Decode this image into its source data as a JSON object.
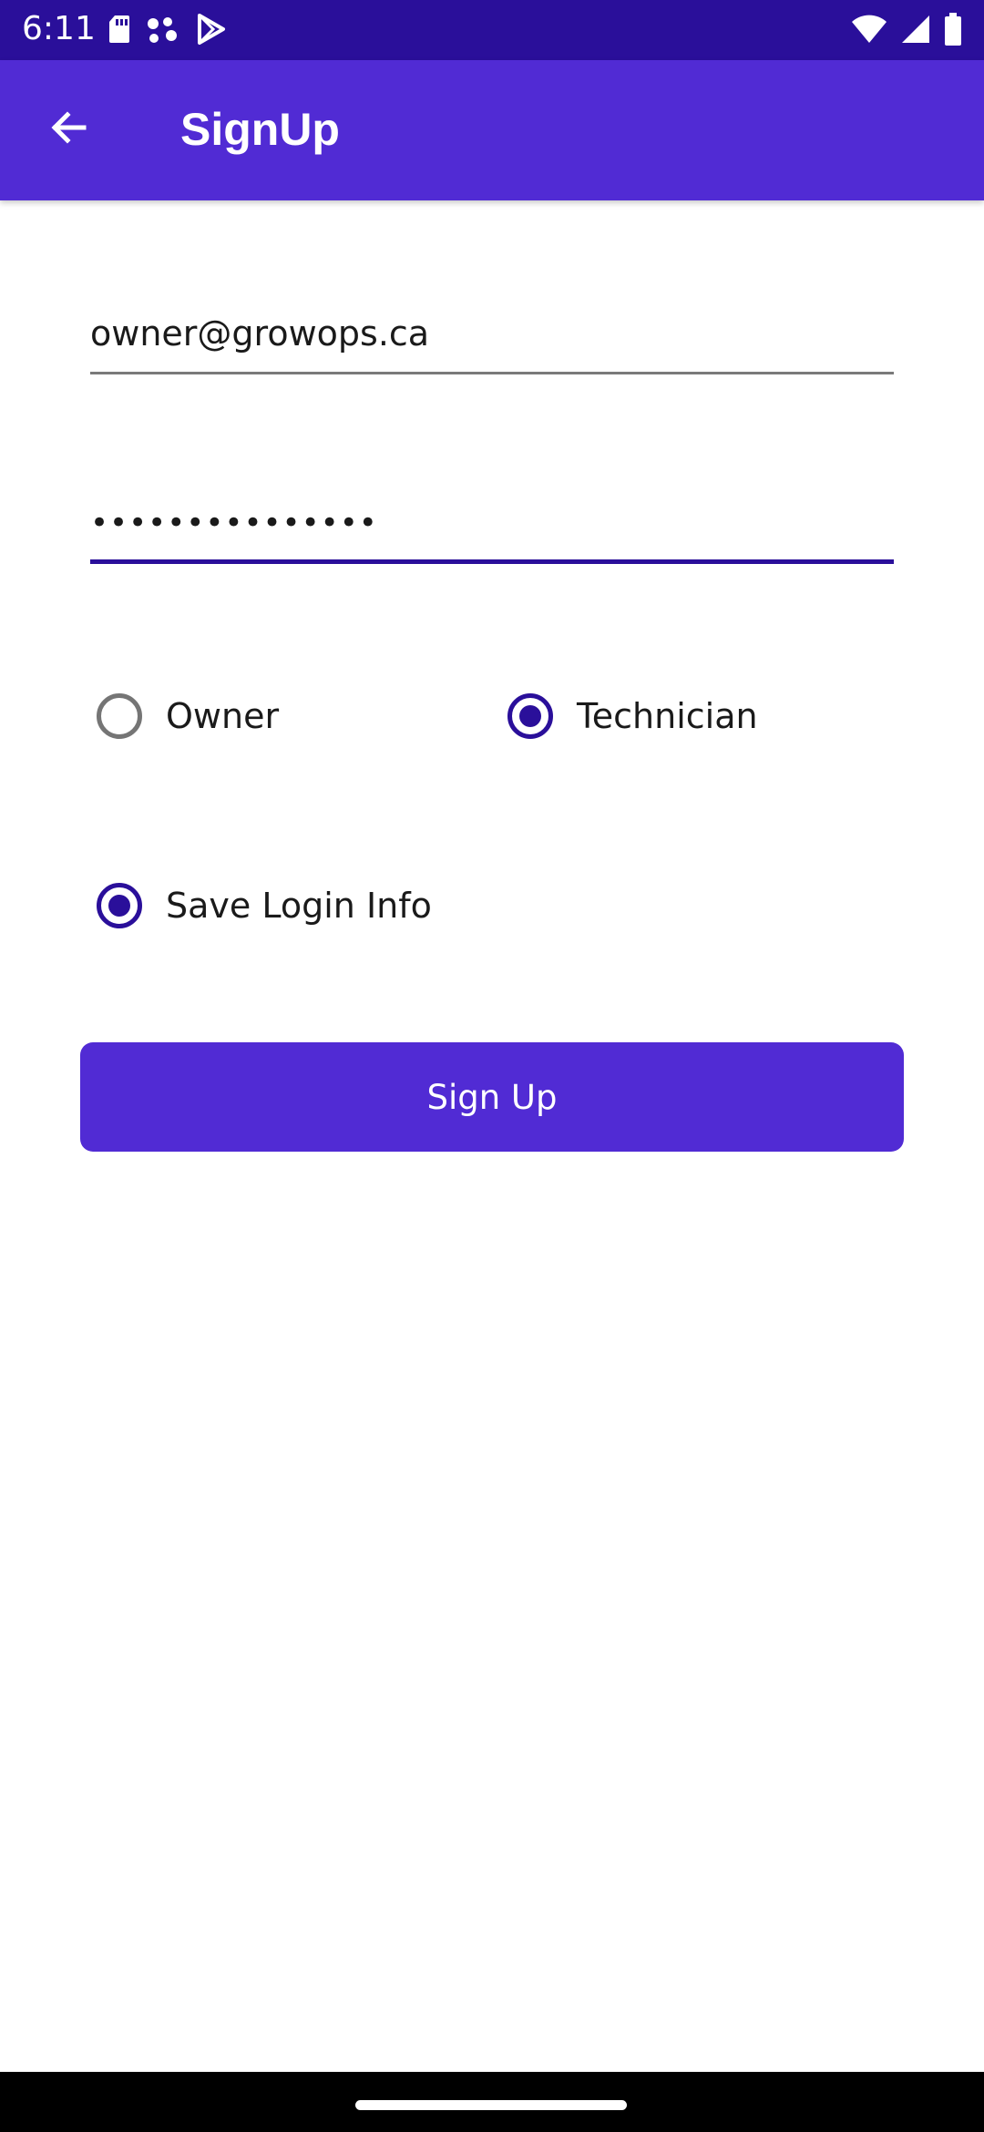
{
  "status_bar": {
    "time": "6:11",
    "left_icons": [
      "sd-card-icon",
      "assistant-dots-icon",
      "play-store-icon"
    ],
    "right_icons": [
      "wifi-icon",
      "cellular-signal-icon",
      "battery-icon"
    ],
    "background_color": "#2a0f9a"
  },
  "app_bar": {
    "title": "SignUp",
    "back_icon": "arrow-left-icon",
    "background_color": "#512bd4"
  },
  "form": {
    "email": {
      "value": "owner@growops.ca",
      "placeholder": ""
    },
    "password": {
      "value": "•••••••••••••••",
      "placeholder": ""
    },
    "role": {
      "options": [
        {
          "label": "Owner",
          "selected": false
        },
        {
          "label": "Technician",
          "selected": true
        }
      ]
    },
    "save_login": {
      "label": "Save Login Info",
      "checked": true
    },
    "submit_label": "Sign Up"
  },
  "colors": {
    "accent": "#512bd4",
    "accent_dark": "#2a0f9a",
    "text": "#1a1a1a",
    "unchecked": "#757575"
  }
}
